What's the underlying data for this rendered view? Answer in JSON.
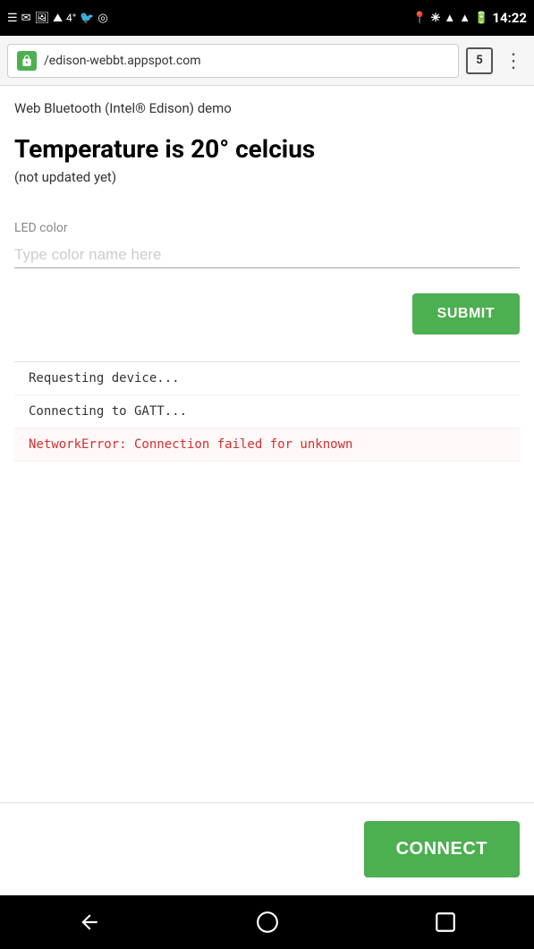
{
  "statusBar": {
    "time": "14:22",
    "tabCount": "5"
  },
  "addressBar": {
    "url": "/edison-webbt.appspot.com"
  },
  "page": {
    "title": "Web Bluetooth (Intel® Edison) demo",
    "temperatureHeading": "Temperature is 20° celcius",
    "notUpdated": "(not updated yet)",
    "ledLabel": "LED color",
    "ledPlaceholder": "Type color name here",
    "submitLabel": "SUBMIT",
    "connectLabel": "CONNECT"
  },
  "log": [
    {
      "text": "Requesting device...",
      "type": "info"
    },
    {
      "text": "Connecting to GATT...",
      "type": "info"
    },
    {
      "text": "NetworkError: Connection failed for unknown",
      "type": "error"
    }
  ]
}
